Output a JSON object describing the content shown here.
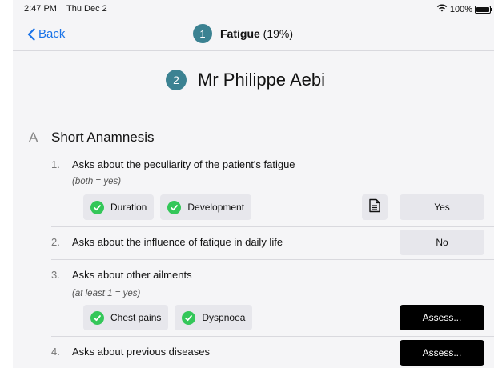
{
  "status_bar": {
    "time": "2:47 PM",
    "date": "Thu Dec 2",
    "battery": "100%",
    "battery_level": 1.0,
    "wifi_icon": "wifi-icon",
    "battery_icon": "battery-icon"
  },
  "nav": {
    "back_label": "Back",
    "badge": "1",
    "title": "Fatigue",
    "title_suffix": "(19%)"
  },
  "patient": {
    "badge": "2",
    "name": "Mr Philippe Aebi"
  },
  "section": {
    "letter": "A",
    "title": "Short Anamnesis"
  },
  "items": [
    {
      "num": "1.",
      "text": "Asks about the peculiarity of the patient's fatigue",
      "hint": "(both = yes)",
      "chips": [
        "Duration",
        "Development"
      ],
      "answer": "Yes"
    },
    {
      "num": "2.",
      "text": "Asks about the influence of fatique in daily life",
      "answer": "No"
    },
    {
      "num": "3.",
      "text": "Asks about other ailments",
      "hint": "(at least 1 = yes)",
      "chips": [
        "Chest pains",
        "Dyspnoea"
      ],
      "answer": "Assess..."
    },
    {
      "num": "4.",
      "text": "Asks about previous diseases",
      "answer": "Assess..."
    }
  ],
  "colors": {
    "accent": "#1a73e8",
    "badge": "#3b8292",
    "check": "#34c759"
  }
}
